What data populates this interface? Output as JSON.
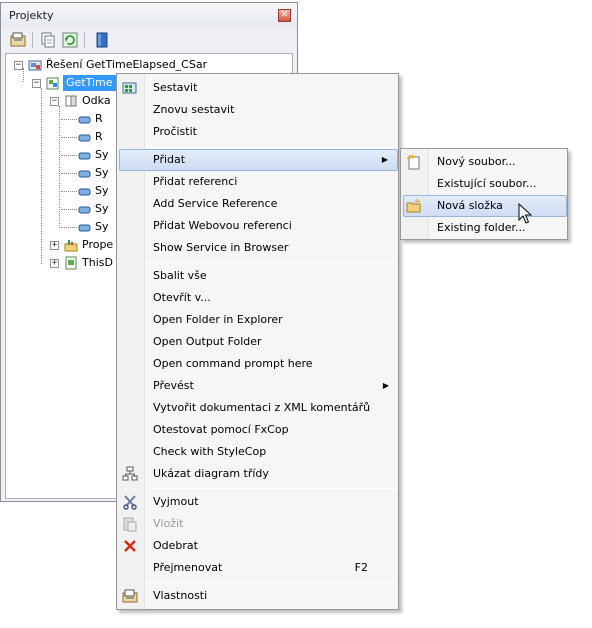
{
  "panel": {
    "title": "Projekty",
    "close_glyph": "✕",
    "toolbar": [
      "properties-icon",
      "show-all-files-icon",
      "refresh-icon",
      "view-class-diagram-icon"
    ]
  },
  "tree": {
    "solution": "Řešení GetTimeElapsed_CSar",
    "project": "GetTime",
    "references": "Odka",
    "ref_items": [
      "R",
      "R",
      "Sy",
      "Sy",
      "Sy",
      "Sy",
      "Sy"
    ],
    "properties": "Prope",
    "thisdoc": "ThisD"
  },
  "menu": {
    "items": [
      {
        "label": "Sestavit",
        "icon": "build-icon"
      },
      {
        "label": "Znovu sestavit"
      },
      {
        "label": "Pročistit"
      },
      {
        "label": "Přidat",
        "submenu": true
      },
      {
        "label": "Přidat referenci"
      },
      {
        "label": "Add Service Reference"
      },
      {
        "label": "Přidat Webovou referenci"
      },
      {
        "label": "Show Service in Browser"
      },
      {
        "label": "Sbalit vše"
      },
      {
        "label": "Otevřít v..."
      },
      {
        "label": "Open Folder in Explorer"
      },
      {
        "label": "Open Output Folder"
      },
      {
        "label": "Open command prompt here"
      },
      {
        "label": "Převést",
        "submenu": true
      },
      {
        "label": "Vytvořit dokumentaci z XML komentářů"
      },
      {
        "label": "Otestovat pomocí FxCop"
      },
      {
        "label": "Check with StyleCop"
      },
      {
        "label": "Ukázat diagram třídy",
        "icon": "class-diagram-icon"
      },
      {
        "label": "Vyjmout",
        "icon": "cut-icon"
      },
      {
        "label": "Vložit",
        "icon": "paste-icon",
        "disabled": true
      },
      {
        "label": "Odebrat",
        "icon": "delete-icon"
      },
      {
        "label": "Přejmenovat",
        "shortcut": "F2"
      },
      {
        "label": "Vlastnosti",
        "icon": "properties-icon"
      }
    ],
    "arrow_glyph": "▶"
  },
  "submenu": {
    "items": [
      {
        "label": "Nový soubor...",
        "icon": "new-file-icon"
      },
      {
        "label": "Existující soubor..."
      },
      {
        "label": "Nová složka",
        "icon": "new-folder-icon",
        "highlighted": true
      },
      {
        "label": "Existing folder..."
      }
    ]
  },
  "colors": {
    "selection": "#3399ff",
    "menu_highlight": "#cfdcf3",
    "menu_bg": "#f6f6f6"
  }
}
